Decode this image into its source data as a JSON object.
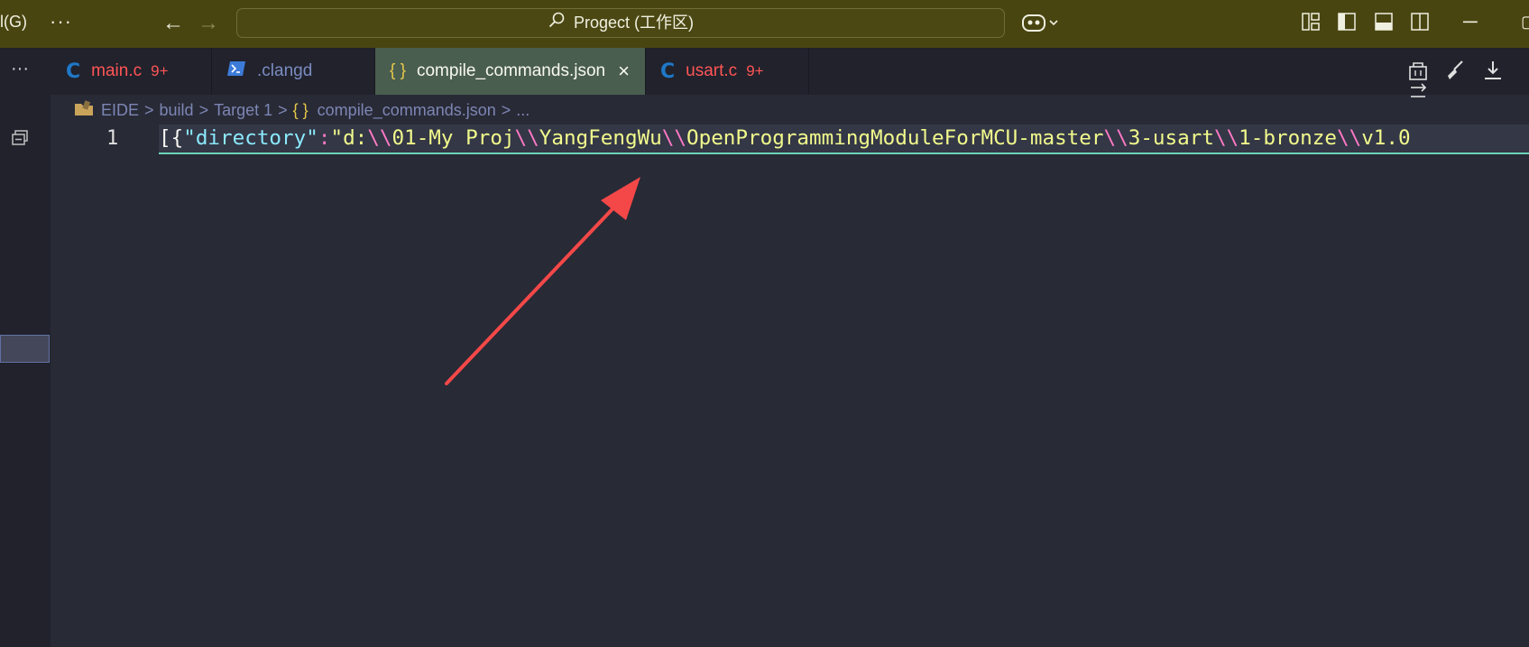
{
  "titlebar": {
    "menu_fragment": "l(G)",
    "more_label": "···",
    "command_center": "Progect (工作区)",
    "copilot_icon": "copilot-icon",
    "minimize_label": "─"
  },
  "tabs": [
    {
      "icon": "C",
      "name": "main.c",
      "badge": "9+",
      "active": false
    },
    {
      "name": ".clangd",
      "active": false
    },
    {
      "icon": "{ }",
      "name": "compile_commands.json",
      "active": true,
      "close": "×"
    },
    {
      "icon": "C",
      "name": "usart.c",
      "badge": "9+",
      "active": false
    }
  ],
  "breadcrumb": {
    "items": [
      "EIDE",
      "build",
      "Target 1"
    ],
    "file": "compile_commands.json",
    "file_icon": "{ }",
    "tail": "...",
    "separator": ">"
  },
  "editor": {
    "line_number": "1",
    "tokens": [
      {
        "cls": "tok-bracket",
        "text": "[{"
      },
      {
        "cls": "tok-key",
        "text": "\"directory\""
      },
      {
        "cls": "tok-punct",
        "text": ":"
      },
      {
        "cls": "tok-str",
        "text": "\"d:"
      },
      {
        "cls": "tok-esc",
        "text": "\\\\"
      },
      {
        "cls": "tok-str",
        "text": "01-My Proj"
      },
      {
        "cls": "tok-esc",
        "text": "\\\\"
      },
      {
        "cls": "tok-str",
        "text": "YangFengWu"
      },
      {
        "cls": "tok-esc",
        "text": "\\\\"
      },
      {
        "cls": "tok-str",
        "text": "OpenProgrammingModuleForMCU-master"
      },
      {
        "cls": "tok-esc",
        "text": "\\\\"
      },
      {
        "cls": "tok-str",
        "text": "3-usart"
      },
      {
        "cls": "tok-esc",
        "text": "\\\\"
      },
      {
        "cls": "tok-str",
        "text": "1-bronze"
      },
      {
        "cls": "tok-esc",
        "text": "\\\\"
      },
      {
        "cls": "tok-str",
        "text": "v1.0"
      }
    ]
  },
  "colors": {
    "titlebar_bg": "#494511",
    "editor_bg": "#282a36",
    "active_tab_bg": "#4a5e4f",
    "arrow": "#f44848",
    "error": "#ff5555"
  }
}
